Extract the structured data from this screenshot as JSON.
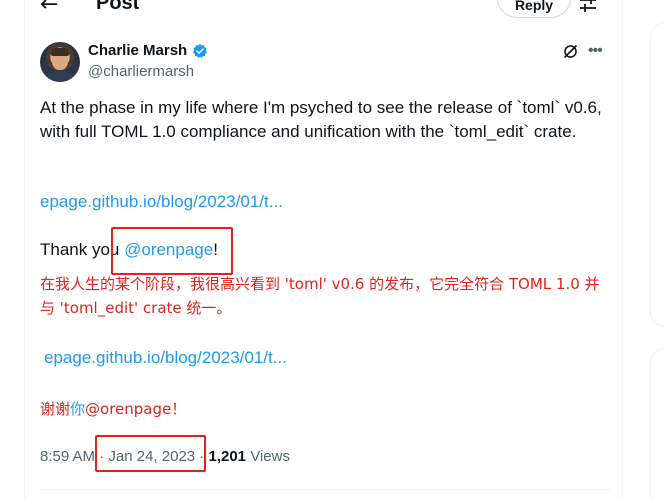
{
  "header": {
    "title": "Post",
    "back_icon": "arrow-left-icon",
    "reply_label": "Reply"
  },
  "tweet": {
    "author_name": "Charlie Marsh",
    "author_handle": "@charliermarsh",
    "verified_icon": "verified-badge-icon",
    "text": "At the phase in my life where I'm psyched to see the release of `toml` v0.6, with full TOML 1.0 compliance and unification with the `toml_edit` crate.",
    "link": "epage.github.io/blog/2023/01/t...",
    "thanks_prefix": "Thank you ",
    "mention": "@orenpage",
    "thanks_suffix": "!",
    "translation": "在我人生的某个阶段，我很高兴看到 'toml' v0.6 的发布，它完全符合 TOML 1.0 并与 'toml_edit' crate 统一。",
    "translation_link": "epage.github.io/blog/2023/01/t...",
    "translation_thanks_prefix": "谢谢",
    "translation_thanks_blue": "你",
    "translation_thanks_suffix": "@orenpage！",
    "time": "8:59 AM",
    "sep1": " · ",
    "date": "Jan 24, 2023",
    "sep2": " · ",
    "views_count": "1,201",
    "views_label": " Views"
  },
  "colors": {
    "accent": "#1d9bf0",
    "annotation_red": "#e0241c",
    "verified": "#1d9bf0",
    "secondary_text": "#536471"
  }
}
